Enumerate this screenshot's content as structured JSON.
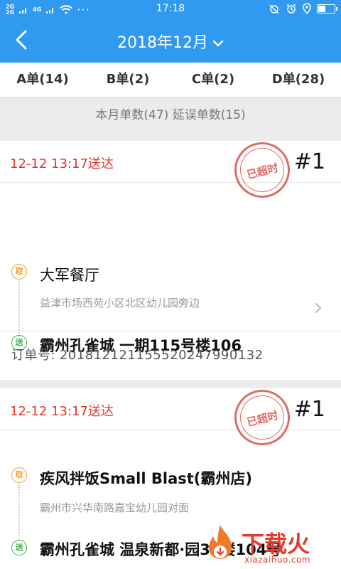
{
  "status_bar": {
    "signal_1": "2G",
    "signal_2": "4G",
    "signal_3": "2G",
    "dots": "···",
    "time": "17:18"
  },
  "navbar": {
    "title": "2018年12月"
  },
  "tabs": [
    {
      "label": "A单(14)"
    },
    {
      "label": "B单(2)"
    },
    {
      "label": "C单(2)"
    },
    {
      "label": "D单(28)"
    }
  ],
  "summary": "本月单数(47) 延误单数(15)",
  "orders": [
    {
      "deliver_time": "12-12 13:17送达",
      "index": "#1",
      "stamp": "已超时",
      "pick_tag": "取",
      "shop_name": "大军餐厅",
      "shop_address": "益津市场西苑小区北区幼儿园旁边",
      "send_tag": "送",
      "destination": "霸州孔雀城 一期115号楼106",
      "order_no_label": "订单号:",
      "order_no": "2018121211555202479901​32"
    },
    {
      "deliver_time": "12-12 13:17送达",
      "index": "#1",
      "stamp": "已超时",
      "pick_tag": "取",
      "shop_name": "疾风拌饭Small Blast(霸州店)",
      "shop_address": "霸州市兴华南路嘉宝幼儿园对面",
      "send_tag": "送",
      "destination": "霸州孔雀城 温泉新都·园38楼104号"
    }
  ],
  "watermark": {
    "text": "下载火",
    "sub": "xiazaihuo.com"
  },
  "colors": {
    "primary": "#2f9af0",
    "alert": "#e8352b",
    "pick": "#f19a2e",
    "send": "#3cb34a"
  }
}
